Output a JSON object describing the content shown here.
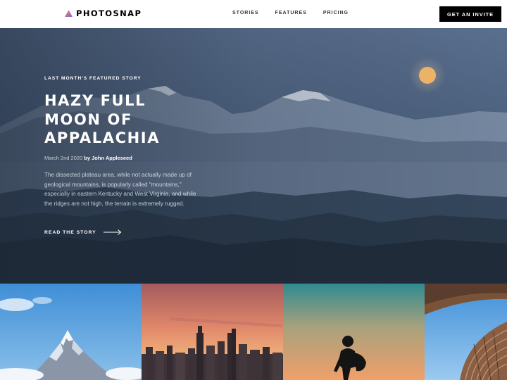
{
  "header": {
    "brand": "PHOTOSNAP",
    "logo_icon": "photosnap-logo-icon",
    "nav": [
      {
        "label": "STORIES"
      },
      {
        "label": "FEATURES"
      },
      {
        "label": "PRICING"
      }
    ],
    "cta_label": "GET AN INVITE"
  },
  "hero": {
    "eyebrow": "LAST MONTH'S FEATURED STORY",
    "title": "HAZY FULL MOON OF APPALACHIA",
    "date": "March 2nd 2020",
    "byline": "by John Appleseed",
    "description": "The dissected plateau area, while not actually made up of geological mountains, is popularly called \"mountains,\" especially in eastern Kentucky and West Virginia, and while the ridges are not high, the terrain is extremely rugged.",
    "cta_label": "READ THE STORY",
    "cta_icon": "arrow-right-icon"
  },
  "tiles": [
    {
      "subject": "snowy mountain peak"
    },
    {
      "subject": "city skyline at sunset"
    },
    {
      "subject": "hiker silhouette at dusk"
    },
    {
      "subject": "curved modern building"
    }
  ]
}
